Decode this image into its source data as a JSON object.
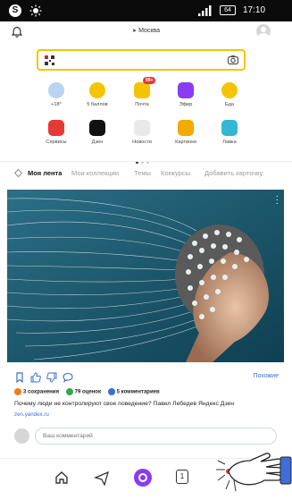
{
  "status_bar": {
    "time": "17:10",
    "battery": "64"
  },
  "header": {
    "location": "Москва"
  },
  "search": {
    "value": "",
    "placeholder": ""
  },
  "services": [
    {
      "label": "+18°",
      "icon": "weather-cloud-icon",
      "color": "#b8d4f0"
    },
    {
      "label": "5 баллов",
      "icon": "traffic-icon",
      "color": "#f5c400"
    },
    {
      "label": "Почта",
      "icon": "mail-icon",
      "color": "#f5c400",
      "badge": "99+"
    },
    {
      "label": "Эфир",
      "icon": "efir-icon",
      "color": "#8a3cf0"
    },
    {
      "label": "Еда",
      "icon": "food-icon",
      "color": "#f5c400"
    },
    {
      "label": "Сервисы",
      "icon": "yandex-services-icon",
      "color": "#e53935"
    },
    {
      "label": "Дзен",
      "icon": "zen-icon",
      "color": "#111111"
    },
    {
      "label": "Новости",
      "icon": "news-icon",
      "color": "#e9e9e9"
    },
    {
      "label": "Картинки",
      "icon": "images-icon",
      "color": "#f2a900"
    },
    {
      "label": "Лавка",
      "icon": "lavka-icon",
      "color": "#35b6d3"
    }
  ],
  "feed_tabs": {
    "items": [
      "Моя лента",
      "Мои коллекции",
      "Темы",
      "Конкурсы",
      "Добавить карточку"
    ]
  },
  "card": {
    "similar": "Похожие",
    "stats": [
      {
        "text": "3 сохранения",
        "color": "#f07c1a"
      },
      {
        "text": "79 оценок",
        "color": "#2fa84f"
      },
      {
        "text": "5 комментариев",
        "color": "#3b6fd1"
      }
    ],
    "title": "Почему люди не контролируют свое поведение? Павел Лебедев Яндекс Дзен",
    "source": "zen.yandex.ru",
    "comment_placeholder": "Ваш комментарий"
  },
  "bottom_nav": {
    "tab_count": "1"
  },
  "colors": {
    "accent_yellow": "#f5c400",
    "link_blue": "#3b6fd1",
    "alice_purple": "#8a3cf0"
  }
}
